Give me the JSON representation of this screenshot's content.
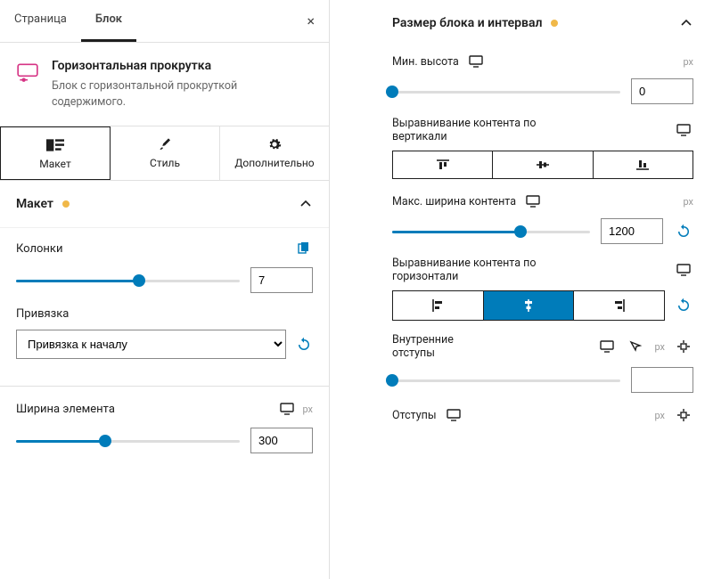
{
  "tabs": {
    "page": "Страница",
    "block": "Блок"
  },
  "block": {
    "title": "Горизонтальная прокрутка",
    "desc": "Блок с горизонтальной прокруткой содержимого."
  },
  "modeTabs": {
    "layout": "Макет",
    "style": "Стиль",
    "advanced": "Дополнительно"
  },
  "sections": {
    "layout_title": "Макет",
    "size_title": "Размер блока и интервал"
  },
  "layout": {
    "columns_label": "Колонки",
    "columns_value": "7",
    "binding_label": "Привязка",
    "binding_value": "Привязка к началу",
    "item_width_label": "Ширина элемента",
    "item_width_value": "300",
    "unit_px": "px"
  },
  "size": {
    "min_height_label": "Мин. высота",
    "min_height_value": "0",
    "valign_label": "Выравнивание контента по вертикали",
    "max_width_label": "Макс. ширина контента",
    "max_width_value": "1200",
    "halign_label": "Выравнивание контента по горизонтали",
    "padding_label": "Внутренние отступы",
    "padding_value": "",
    "margin_label": "Отступы",
    "unit_px": "px"
  }
}
